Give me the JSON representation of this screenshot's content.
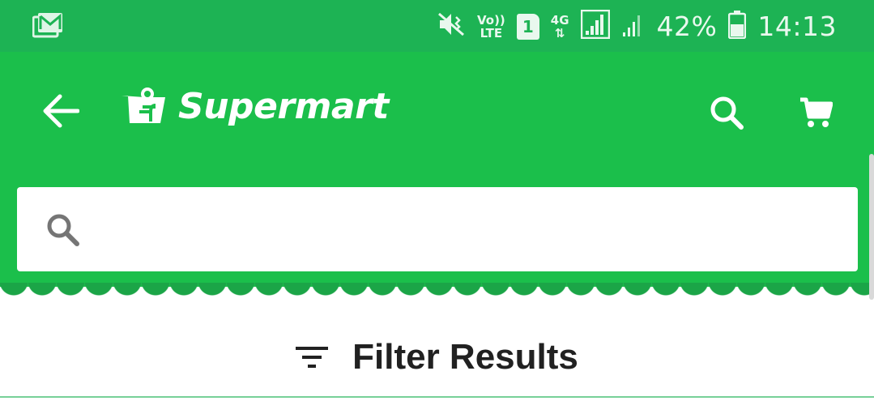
{
  "status_bar": {
    "notification_icon": "gmail-icon",
    "icons": [
      "mute-vibrate-icon",
      "volte-icon",
      "sim-1-icon",
      "4g-data-icon",
      "signal-icon",
      "signal-2-icon",
      "battery-icon"
    ],
    "volte_top": "Vo))",
    "volte_bottom": "LTE",
    "sim_label": "1",
    "network_label": "4G",
    "battery_percent": "42%",
    "time": "14:13",
    "color": "#1db354"
  },
  "app_bar": {
    "brand": "Supermart",
    "back_icon": "back-arrow-icon",
    "search_icon": "search-icon",
    "cart_icon": "cart-icon",
    "color": "#1bbf4b"
  },
  "search": {
    "value": "",
    "placeholder": "",
    "icon": "search-icon"
  },
  "filter": {
    "icon": "filter-icon",
    "label": "Filter Results"
  }
}
